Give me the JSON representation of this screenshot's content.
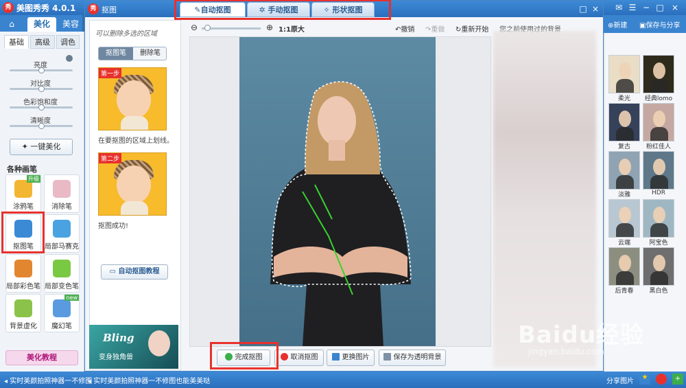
{
  "app": {
    "title": "美图秀秀 4.0.1",
    "logo": "秀"
  },
  "main_tabs": [
    "美化",
    "美容"
  ],
  "home_icon": "home-icon",
  "left": {
    "subtabs": [
      "基础",
      "高级",
      "调色"
    ],
    "sliders": [
      {
        "label": "亮度",
        "value": 0.5
      },
      {
        "label": "对比度",
        "value": 0.5
      },
      {
        "label": "色彩饱和度",
        "value": 0.5
      },
      {
        "label": "清晰度",
        "value": 0.5
      }
    ],
    "one_click": "一键美化",
    "brush_section": "各种画笔",
    "tools": [
      {
        "label": "涂鸦笔",
        "color": "#f2b632",
        "badge": "升级"
      },
      {
        "label": "消除笔",
        "color": "#e9b9c6",
        "badge": ""
      },
      {
        "label": "抠图笔",
        "color": "#3a8ad6",
        "badge": ""
      },
      {
        "label": "局部马赛克",
        "color": "#4aa3e0",
        "badge": ""
      },
      {
        "label": "局部彩色笔",
        "color": "#e2862f",
        "badge": ""
      },
      {
        "label": "局部变色笔",
        "color": "#7ac943",
        "badge": ""
      },
      {
        "label": "背景虚化",
        "color": "#8bc34a",
        "badge": ""
      },
      {
        "label": "魔幻笔",
        "color": "#5a9be0",
        "badge": "new"
      }
    ],
    "tutorial": "美化教程"
  },
  "dialog": {
    "title": "抠图",
    "tabs": [
      "自动抠图",
      "手动抠图",
      "形状抠图"
    ],
    "guide_note": "可以删除多选的区域",
    "brush_toggle": [
      "抠图笔",
      "删除笔"
    ],
    "step1_tag": "第一步",
    "step1_caption": "在要抠图的区域上划线。",
    "step2_tag": "第二步",
    "step2_caption": "抠图成功!",
    "tutorial_button": "自动抠图教程",
    "ad": {
      "title": "Bling",
      "subtitle": "变身独角兽"
    },
    "zoom_label": "1:1原大",
    "zoom_level": 0.05,
    "undo": "撤销",
    "redo": "重做",
    "restart": "重新开始",
    "history_label": "您之前使用过的背景",
    "buttons": {
      "complete": "完成抠图",
      "cancel": "取消抠图",
      "change": "更换图片",
      "save": "保存为透明背景"
    }
  },
  "right": {
    "new_label": "新建",
    "save_share": "保存与分享",
    "effects": [
      "柔光",
      "经典lomo",
      "复古",
      "粉红佳人",
      "淡雅",
      "HDR",
      "云端",
      "阿宝色",
      "后青春",
      "黑白色"
    ],
    "share_label": "分享图片"
  },
  "status": {
    "left_text": "实时美颜拍照神器一不修图",
    "main_text": "实时美颜拍照神器一不修图也能美美哒"
  },
  "watermark": {
    "main": "Baidu经验",
    "sub": "jingyan.baidu.com"
  }
}
